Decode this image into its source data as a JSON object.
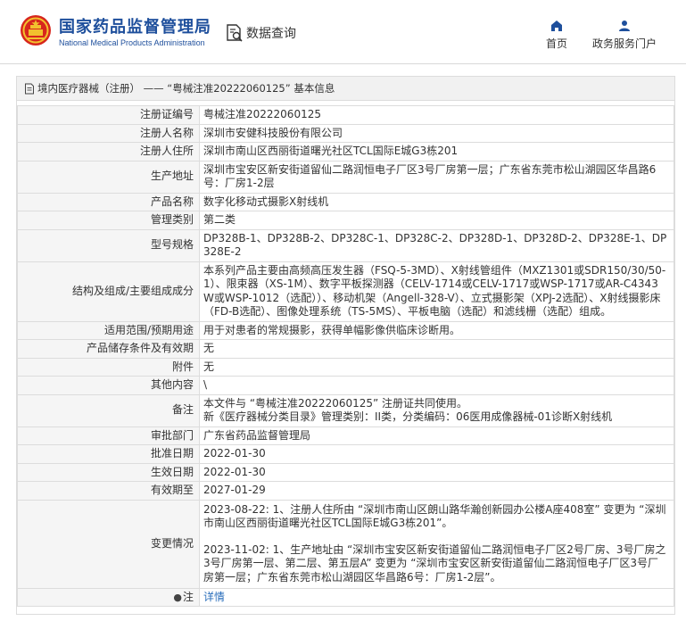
{
  "header": {
    "brand_cn": "国家药品监督管理局",
    "brand_en": "National Medical Products Administration",
    "data_query": "数据查询",
    "nav_home": "首页",
    "nav_portal": "政务服务门户",
    "brand_color": "#1e4f9c",
    "logo_red": "#d7261d",
    "logo_gold": "#f2c12e"
  },
  "panel": {
    "title": "境内医疗器械（注册） —— “粤械注准20222060125” 基本信息"
  },
  "rows": [
    {
      "label": "注册证编号",
      "value": "粤械注准20222060125"
    },
    {
      "label": "注册人名称",
      "value": "深圳市安健科技股份有限公司"
    },
    {
      "label": "注册人住所",
      "value": "深圳市南山区西丽街道曙光社区TCL国际E城G3栋201"
    },
    {
      "label": "生产地址",
      "value": "深圳市宝安区新安街道留仙二路润恒电子厂区3号厂房第一层；广东省东莞市松山湖园区华昌路6号：厂房1-2层"
    },
    {
      "label": "产品名称",
      "value": "数字化移动式摄影X射线机"
    },
    {
      "label": "管理类别",
      "value": "第二类"
    },
    {
      "label": "型号规格",
      "value": "DP328B-1、DP328B-2、DP328C-1、DP328C-2、DP328D-1、DP328D-2、DP328E-1、DP328E-2"
    },
    {
      "label": "结构及组成/主要组成成分",
      "value": "本系列产品主要由高频高压发生器（FSQ-5-3MD）、X射线管组件（MXZ1301或SDR150/30/50-1）、限束器（XS-1M）、数字平板探测器（CELV-1714或CELV-1717或WSP-1717或AR-C4343W或WSP-1012（选配））、移动机架（Angell-328-V）、立式摄影架（XPJ-2选配）、X射线摄影床（FD-B选配）、图像处理系统（TS-5MS）、平板电脑（选配）和滤线栅（选配）组成。"
    },
    {
      "label": "适用范围/预期用途",
      "value": "用于对患者的常规摄影，获得单幅影像供临床诊断用。"
    },
    {
      "label": "产品储存条件及有效期",
      "value": "无"
    },
    {
      "label": "附件",
      "value": "无"
    },
    {
      "label": "其他内容",
      "value": "\\"
    },
    {
      "label": "备注",
      "value_lines": [
        "本文件与 “粤械注准20222060125” 注册证共同使用。",
        "新《医疗器械分类目录》管理类别：II类，分类编码：06医用成像器械-01诊断X射线机"
      ]
    },
    {
      "label": "审批部门",
      "value": "广东省药品监督管理局"
    },
    {
      "label": "批准日期",
      "value": "2022-01-30"
    },
    {
      "label": "生效日期",
      "value": "2022-01-30"
    },
    {
      "label": "有效期至",
      "value": "2027-01-29"
    },
    {
      "label": "变更情况",
      "value_lines": [
        "2023-08-22: 1、注册人住所由 “深圳市南山区朗山路华瀚创新园办公楼A座408室” 变更为 “深圳市南山区西丽街道曙光社区TCL国际E城G3栋201”。",
        "",
        "2023-11-02: 1、生产地址由 “深圳市宝安区新安街道留仙二路润恒电子厂区2号厂房、3号厂房之3号厂房第一层、第二层、第五层A” 变更为 “深圳市宝安区新安街道留仙二路润恒电子厂区3号厂房第一层；广东省东莞市松山湖园区华昌路6号：厂房1-2层”。"
      ]
    }
  ],
  "note_row": {
    "label": "注",
    "link": "详情"
  }
}
